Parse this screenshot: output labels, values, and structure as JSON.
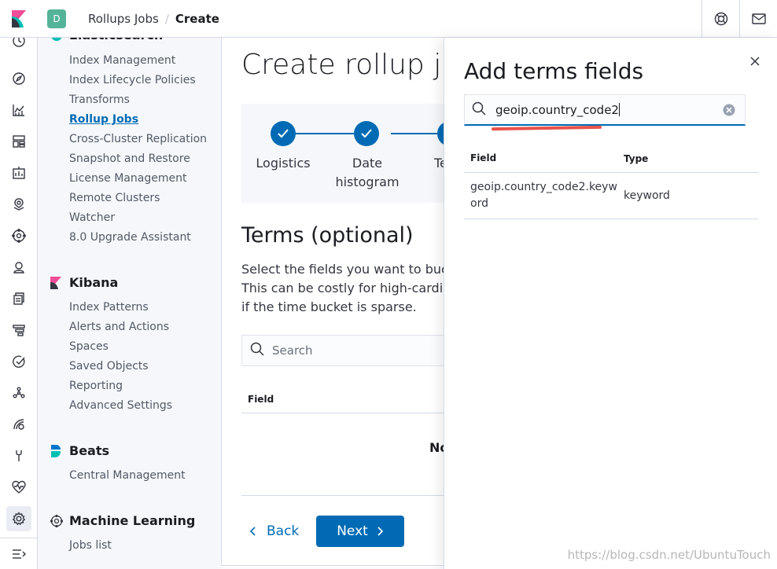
{
  "header": {
    "space_initial": "D",
    "breadcrumbs": [
      "Rollups Jobs",
      "Create"
    ],
    "breadcrumb_separator": "/"
  },
  "sidebar": {
    "elasticsearch_items": [
      "Index Management",
      "Index Lifecycle Policies",
      "Transforms",
      "Rollup Jobs",
      "Cross-Cluster Replication",
      "Snapshot and Restore",
      "License Management",
      "Remote Clusters",
      "Watcher",
      "8.0 Upgrade Assistant"
    ],
    "selected_item": "Rollup Jobs",
    "kibana": {
      "title": "Kibana",
      "items": [
        "Index Patterns",
        "Alerts and Actions",
        "Spaces",
        "Saved Objects",
        "Reporting",
        "Advanced Settings"
      ]
    },
    "beats": {
      "title": "Beats",
      "items": [
        "Central Management"
      ]
    },
    "ml": {
      "title": "Machine Learning",
      "items": [
        "Jobs list"
      ]
    }
  },
  "main": {
    "title": "Create rollup job",
    "steps": [
      "Logistics",
      "Date\nhistogram",
      "Te"
    ],
    "section_title": "Terms (optional)",
    "description_lines": [
      "Select the fields you want to bucke",
      "This can be costly for high-cardina",
      "if the time bucket is sparse."
    ],
    "search_placeholder": "Search",
    "table_header_field": "Field",
    "empty_text": "No",
    "back_label": "Back",
    "next_label": "Next"
  },
  "flyout": {
    "title": "Add terms fields",
    "search_value": "geoip.country_code2",
    "columns": [
      "Field",
      "Type"
    ],
    "rows": [
      {
        "field_line1": "geoip.country_code2.keyw",
        "field_line2": "ord",
        "type": "keyword"
      }
    ]
  },
  "watermark": "https://blog.csdn.net/UbuntuTouch",
  "colors": {
    "primary": "#006bb4",
    "sidebar_bg": "#f5f7fa",
    "space_badge": "#54b399",
    "annotation_underline": "#e8524a"
  }
}
